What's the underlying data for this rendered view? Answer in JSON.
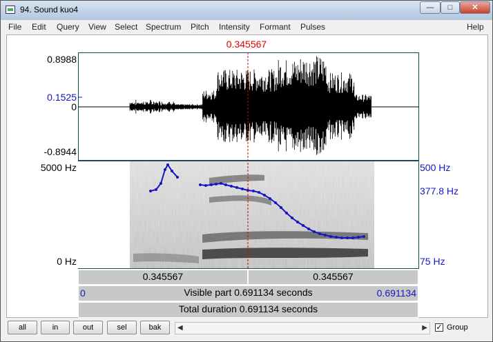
{
  "window": {
    "title": "94. Sound kuo4"
  },
  "titlebar_buttons": {
    "minimize": "—",
    "maximize": "□",
    "close": "✕"
  },
  "menu": [
    "File",
    "Edit",
    "Query",
    "View",
    "Select",
    "Spectrum",
    "Pitch",
    "Intensity",
    "Formant",
    "Pulses",
    "Help"
  ],
  "cursor": {
    "time_label": "0.345567"
  },
  "waveform": {
    "y_max": "0.8988",
    "y_marker": "0.1525",
    "y_zero": "0",
    "y_min": "-0.8944"
  },
  "spectrogram": {
    "freq_max": "5000 Hz",
    "freq_min": "0 Hz"
  },
  "pitch_axis": {
    "top": "500 Hz",
    "marker": "377.8 Hz",
    "bottom": "75 Hz"
  },
  "bars": {
    "left_segment": "0.345567",
    "right_segment": "0.345567",
    "visible_start": "0",
    "visible_part": "Visible part 0.691134 seconds",
    "visible_end": "0.691134",
    "total_duration": "Total duration 0.691134 seconds"
  },
  "bottom_buttons": {
    "all": "all",
    "in": "in",
    "out": "out",
    "sel": "sel",
    "bak": "bak"
  },
  "group": {
    "label": "Group",
    "checked": true
  },
  "colors": {
    "cursor": "#d00000",
    "pitch": "#1515c8",
    "axis_blue": "#1515c8"
  }
}
